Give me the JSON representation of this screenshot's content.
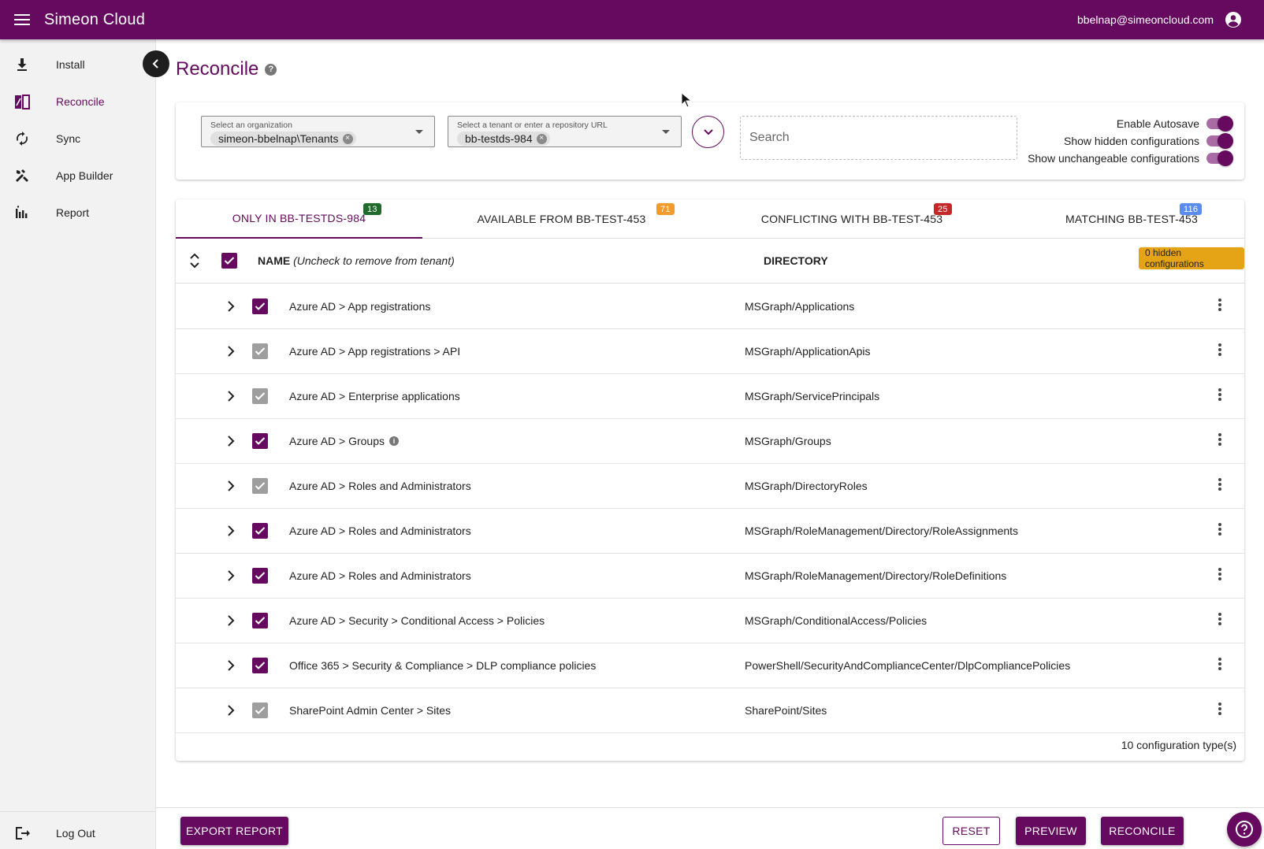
{
  "app": {
    "brand": "Simeon Cloud",
    "user_email": "bbelnap@simeoncloud.com"
  },
  "sidebar": {
    "items": [
      {
        "label": "Install",
        "icon": "download-icon"
      },
      {
        "label": "Reconcile",
        "icon": "reconcile-icon",
        "active": true
      },
      {
        "label": "Sync",
        "icon": "sync-icon"
      },
      {
        "label": "App Builder",
        "icon": "build-tools-icon"
      },
      {
        "label": "Report",
        "icon": "bar-chart-icon"
      }
    ],
    "logout_label": "Log Out"
  },
  "page": {
    "title": "Reconcile"
  },
  "filters": {
    "organization": {
      "placeholder": "Select an organization",
      "value": "simeon-bbelnap\\Tenants"
    },
    "tenant": {
      "placeholder": "Select a tenant or enter a repository URL",
      "value": "bb-testds-984"
    },
    "search_placeholder": "Search",
    "toggles": [
      {
        "label": "Enable Autosave",
        "on": true
      },
      {
        "label": "Show hidden configurations",
        "on": true
      },
      {
        "label": "Show unchangeable configurations",
        "on": true
      }
    ]
  },
  "tabs": [
    {
      "label": "ONLY IN BB-TESTDS-984",
      "count": "13",
      "badge_color": "#1e6b2b",
      "active": true
    },
    {
      "label": "AVAILABLE FROM BB-TEST-453",
      "count": "71",
      "badge_color": "#f39c2b"
    },
    {
      "label": "CONFLICTING WITH BB-TEST-453",
      "count": "25",
      "badge_color": "#c62828"
    },
    {
      "label": "MATCHING BB-TEST-453",
      "count": "116",
      "badge_color": "#5b8def"
    }
  ],
  "table": {
    "header": {
      "name": "NAME",
      "name_hint": "(Uncheck to remove from tenant)",
      "directory": "DIRECTORY",
      "hidden_count": "0 hidden configurations"
    },
    "rows": [
      {
        "name": "Azure AD > App registrations",
        "directory": "MSGraph/Applications",
        "checked": "on"
      },
      {
        "name": "Azure AD > App registrations > API",
        "directory": "MSGraph/ApplicationApis",
        "checked": "grey"
      },
      {
        "name": "Azure AD > Enterprise applications",
        "directory": "MSGraph/ServicePrincipals",
        "checked": "grey"
      },
      {
        "name": "Azure AD > Groups",
        "directory": "MSGraph/Groups",
        "checked": "on",
        "info": true
      },
      {
        "name": "Azure AD > Roles and Administrators",
        "directory": "MSGraph/DirectoryRoles",
        "checked": "grey"
      },
      {
        "name": "Azure AD > Roles and Administrators",
        "directory": "MSGraph/RoleManagement/Directory/RoleAssignments",
        "checked": "on"
      },
      {
        "name": "Azure AD > Roles and Administrators",
        "directory": "MSGraph/RoleManagement/Directory/RoleDefinitions",
        "checked": "on"
      },
      {
        "name": "Azure AD > Security > Conditional Access > Policies",
        "directory": "MSGraph/ConditionalAccess/Policies",
        "checked": "on"
      },
      {
        "name": "Office 365 > Security & Compliance > DLP compliance policies",
        "directory": "PowerShell/SecurityAndComplianceCenter/DlpCompliancePolicies",
        "checked": "on"
      },
      {
        "name": "SharePoint Admin Center > Sites",
        "directory": "SharePoint/Sites",
        "checked": "grey"
      }
    ],
    "footer": "10 configuration type(s)"
  },
  "actions": {
    "export": "EXPORT REPORT",
    "reset": "RESET",
    "preview": "PREVIEW",
    "reconcile": "RECONCILE"
  }
}
